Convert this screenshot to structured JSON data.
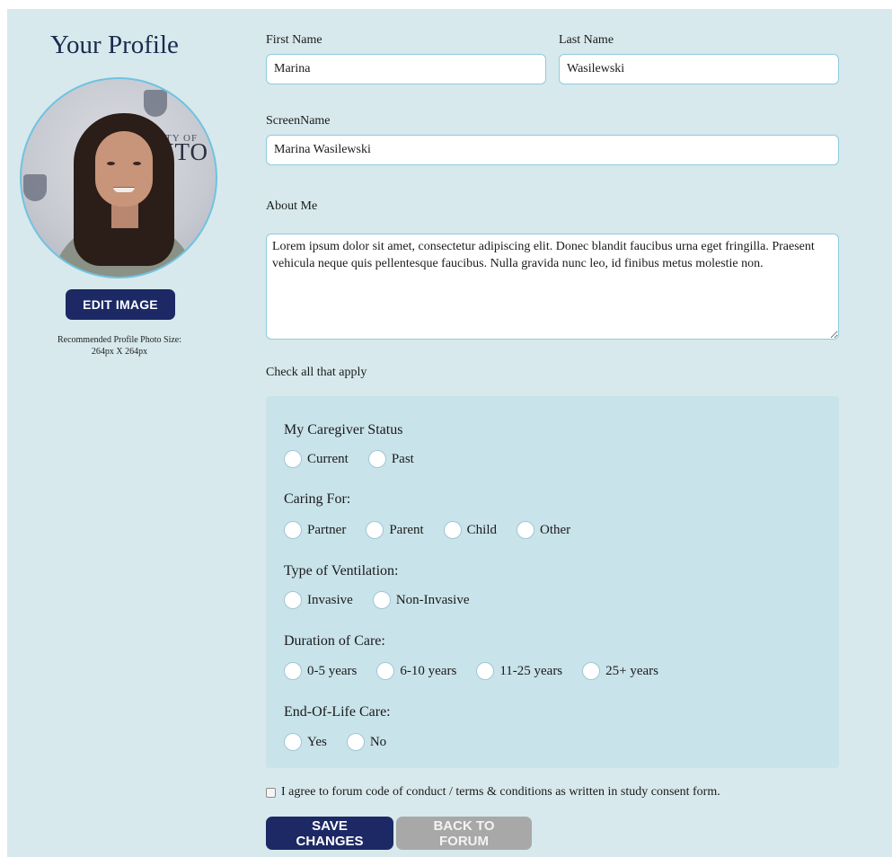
{
  "sidebar": {
    "title": "Your Profile",
    "edit_image_label": "EDIT IMAGE",
    "photo_note_line1": "Recommended Profile Photo Size:",
    "photo_note_line2": "264px X 264px",
    "photo_banner_small": "TY OF",
    "photo_banner_text": "NTO"
  },
  "form": {
    "first_name_label": "First Name",
    "first_name_value": "Marina",
    "last_name_label": "Last Name",
    "last_name_value": "Wasilewski",
    "screen_name_label": "ScreenName",
    "screen_name_value": "Marina Wasilewski",
    "about_label": "About Me",
    "about_value": "Lorem ipsum dolor sit amet, consectetur adipiscing elit. Donec blandit faucibus urna eget fringilla. Praesent vehicula neque quis pellentesque faucibus. Nulla gravida nunc leo, id finibus metus molestie non.",
    "check_all_label": "Check all that apply"
  },
  "groups": [
    {
      "title": "My Caregiver Status",
      "options": [
        "Current",
        "Past"
      ]
    },
    {
      "title": "Caring For:",
      "options": [
        "Partner",
        "Parent",
        "Child",
        "Other"
      ]
    },
    {
      "title": "Type of Ventilation:",
      "options": [
        "Invasive",
        "Non-Invasive"
      ]
    },
    {
      "title": "Duration of Care:",
      "options": [
        "0-5 years",
        "6-10 years",
        "11-25 years",
        "25+ years"
      ]
    },
    {
      "title": "End-Of-Life Care:",
      "options": [
        "Yes",
        "No"
      ]
    }
  ],
  "agreement": {
    "label": "I agree to forum code of conduct / terms & conditions as written in study consent form.",
    "checked": false
  },
  "actions": {
    "save_label": "SAVE CHANGES",
    "back_label": "BACK TO FORUM"
  },
  "colors": {
    "background": "#d7e9ec",
    "options_panel": "#c9e3ea",
    "primary_button": "#1c2965",
    "secondary_button": "#a8a8a8",
    "field_border": "#8fcbe0"
  }
}
